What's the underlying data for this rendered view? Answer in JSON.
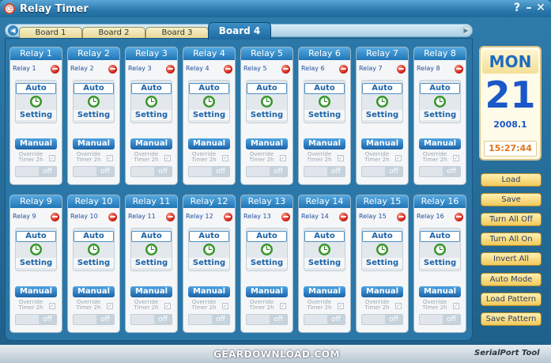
{
  "window": {
    "title": "Relay Timer",
    "help": "?",
    "minimize": "–",
    "close": "✕"
  },
  "tabs": [
    {
      "label": "Board 1"
    },
    {
      "label": "Board 2"
    },
    {
      "label": "Board 3"
    },
    {
      "label": "Board 4"
    }
  ],
  "nav": {
    "left": "◀",
    "right": "▶"
  },
  "relay_common": {
    "auto": "Auto",
    "setting": "Setting",
    "manual": "Manual",
    "override": "Override Timer 2h",
    "check": "✓",
    "off": "off"
  },
  "relays": [
    {
      "title": "Relay 1",
      "label": "Relay 1"
    },
    {
      "title": "Relay 2",
      "label": "Relay 2"
    },
    {
      "title": "Relay 3",
      "label": "Relay 3"
    },
    {
      "title": "Relay 4",
      "label": "Relay 4"
    },
    {
      "title": "Relay 5",
      "label": "Relay 5"
    },
    {
      "title": "Relay 6",
      "label": "Relay 6"
    },
    {
      "title": "Relay 7",
      "label": "Relay 7"
    },
    {
      "title": "Relay 8",
      "label": "Relay 8"
    },
    {
      "title": "Relay 9",
      "label": "Relay 9"
    },
    {
      "title": "Relay 10",
      "label": "Relay 10"
    },
    {
      "title": "Relay 11",
      "label": "Relay 11"
    },
    {
      "title": "Relay 12",
      "label": "Relay 12"
    },
    {
      "title": "Relay 13",
      "label": "Relay 13"
    },
    {
      "title": "Relay 14",
      "label": "Relay 14"
    },
    {
      "title": "Relay 15",
      "label": "Relay 15"
    },
    {
      "title": "Relay 16",
      "label": "Relay 16"
    }
  ],
  "clock": {
    "day": "MON",
    "date": "21",
    "year_month": "2008.1",
    "time": "15:27:44"
  },
  "side_buttons": [
    "Load",
    "Save",
    "Turn All Off",
    "Turn All On",
    "Invert All",
    "Auto Mode",
    "Load Pattern",
    "Save Pattern"
  ],
  "status": {
    "watermark": "GEARDOWNLOAD.COM",
    "brand": "SerialPort Tool"
  },
  "colors": {
    "accent": "#2075b6",
    "led_off": "#d1231a",
    "side_button": "#f1c95a"
  }
}
